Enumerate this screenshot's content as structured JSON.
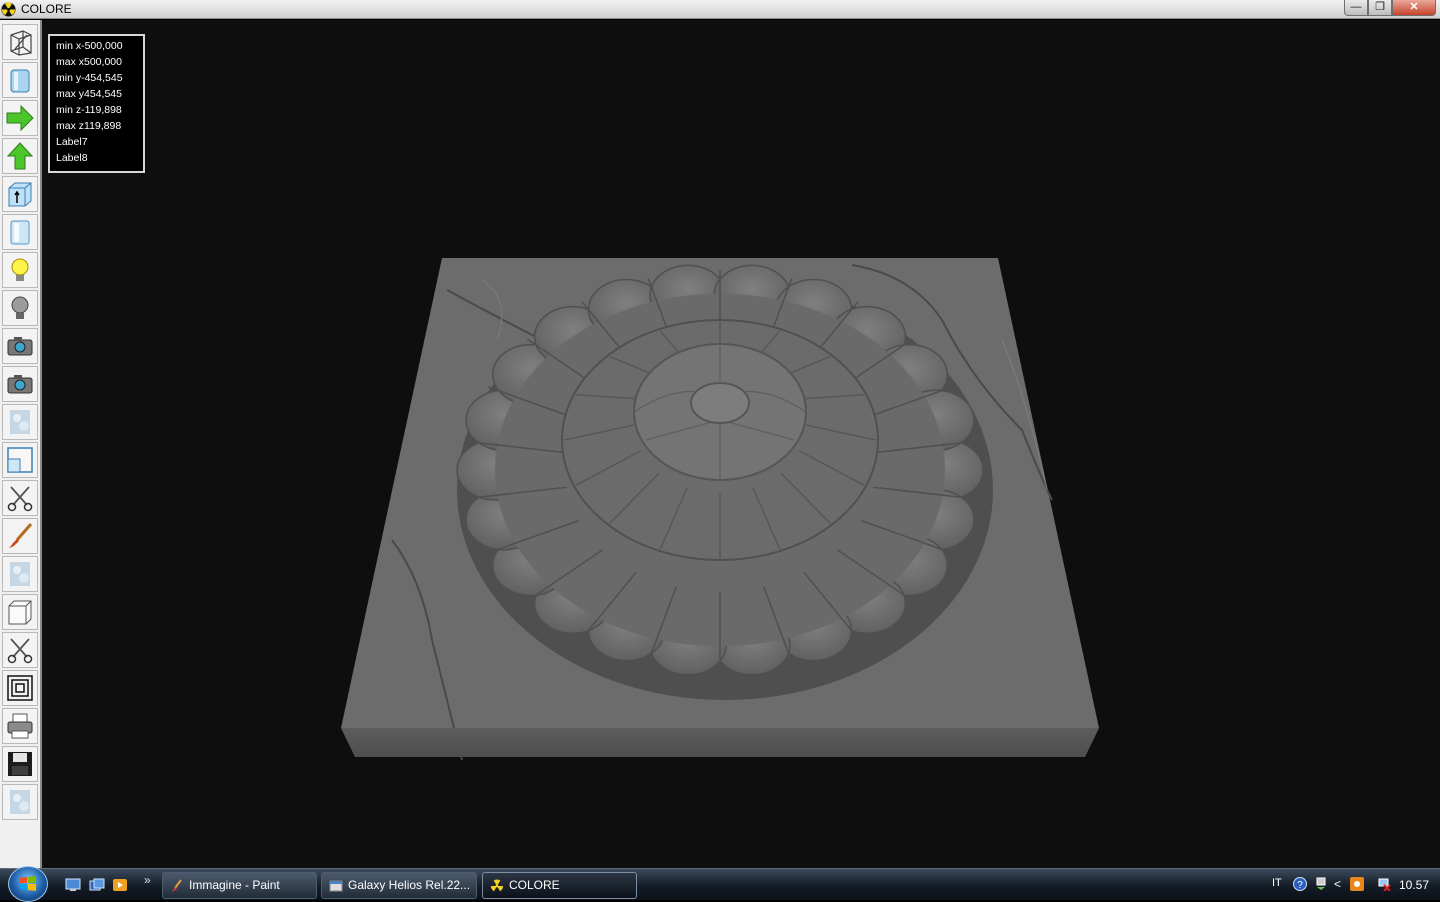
{
  "window": {
    "title": "COLORE",
    "app_icon": "radiation-icon",
    "controls": {
      "minimize": "minimize-icon",
      "maximize": "restore-icon",
      "close": "close-icon"
    }
  },
  "toolbar": {
    "tools": [
      {
        "name": "wireframe-view",
        "icon": "wireframe-box-icon"
      },
      {
        "name": "solid-view",
        "icon": "cylinder-icon"
      },
      {
        "name": "arrow-right",
        "icon": "green-arrow-right-icon"
      },
      {
        "name": "arrow-up",
        "icon": "green-arrow-up-icon"
      },
      {
        "name": "height-info",
        "icon": "box-height-icon"
      },
      {
        "name": "glass-view",
        "icon": "glass-cylinder-icon"
      },
      {
        "name": "light-on",
        "icon": "lightbulb-on-icon"
      },
      {
        "name": "light-off",
        "icon": "lightbulb-off-icon"
      },
      {
        "name": "camera-1",
        "icon": "camera-icon"
      },
      {
        "name": "camera-2",
        "icon": "camera-icon"
      },
      {
        "name": "texture-1",
        "icon": "texture-icon"
      },
      {
        "name": "window-frame",
        "icon": "frame-icon"
      },
      {
        "name": "cut-1",
        "icon": "scissors-icon"
      },
      {
        "name": "paint",
        "icon": "brush-icon"
      },
      {
        "name": "texture-2",
        "icon": "texture-icon"
      },
      {
        "name": "box",
        "icon": "cube-icon"
      },
      {
        "name": "cut-2",
        "icon": "scissors-icon"
      },
      {
        "name": "contours",
        "icon": "concentric-squares-icon"
      },
      {
        "name": "print",
        "icon": "printer-icon"
      },
      {
        "name": "save",
        "icon": "floppy-icon"
      },
      {
        "name": "texture-3",
        "icon": "texture-icon"
      }
    ]
  },
  "info": {
    "lines": [
      "min x-500,000",
      "max x500,000",
      "min y-454,545",
      "max y454,545",
      "min z-119,898",
      "max z119,898",
      "Label7",
      "Label8"
    ]
  },
  "taskbar": {
    "start_icon": "windows-logo-icon",
    "quick_launch": [
      "show-desktop-icon",
      "switch-windows-icon",
      "media-player-icon"
    ],
    "more": "»",
    "tasks": [
      {
        "label": "Immagine - Paint",
        "icon": "paint-icon",
        "active": false
      },
      {
        "label": "Galaxy Helios  Rel.22...",
        "icon": "app-window-icon",
        "active": false
      },
      {
        "label": "COLORE",
        "icon": "radiation-icon",
        "active": true
      }
    ],
    "tray": {
      "language": "IT",
      "clock": "10.57"
    }
  },
  "colors": {
    "viewport_bg": "#0e0e0e",
    "marble": "#6e6e6e",
    "titlebar": "#dcdcdc"
  }
}
